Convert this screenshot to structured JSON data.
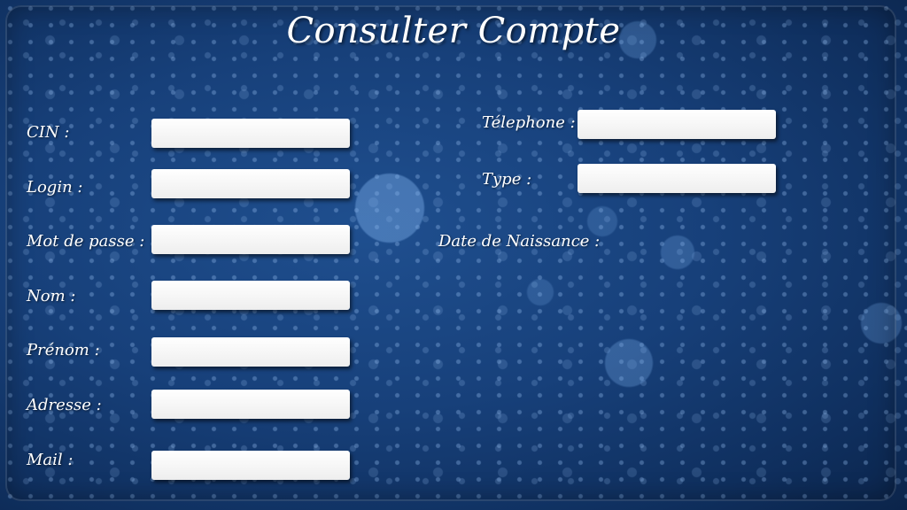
{
  "title": "Consulter Compte",
  "left_form": {
    "fields": [
      {
        "label": "CIN :",
        "value": ""
      },
      {
        "label": "Login :",
        "value": ""
      },
      {
        "label": "Mot de passe :",
        "value": ""
      },
      {
        "label": "Nom :",
        "value": ""
      },
      {
        "label": "Prénom :",
        "value": ""
      },
      {
        "label": "Adresse :",
        "value": ""
      },
      {
        "label": "Mail :",
        "value": ""
      }
    ]
  },
  "right_form": {
    "fields": [
      {
        "label": "Télephone :",
        "value": ""
      },
      {
        "label": "Type :",
        "value": ""
      }
    ],
    "birth_date_label": "Date de Naissance :"
  },
  "colors": {
    "background": "#17407a",
    "field_background": "#ffffff",
    "text": "#ffffff"
  }
}
